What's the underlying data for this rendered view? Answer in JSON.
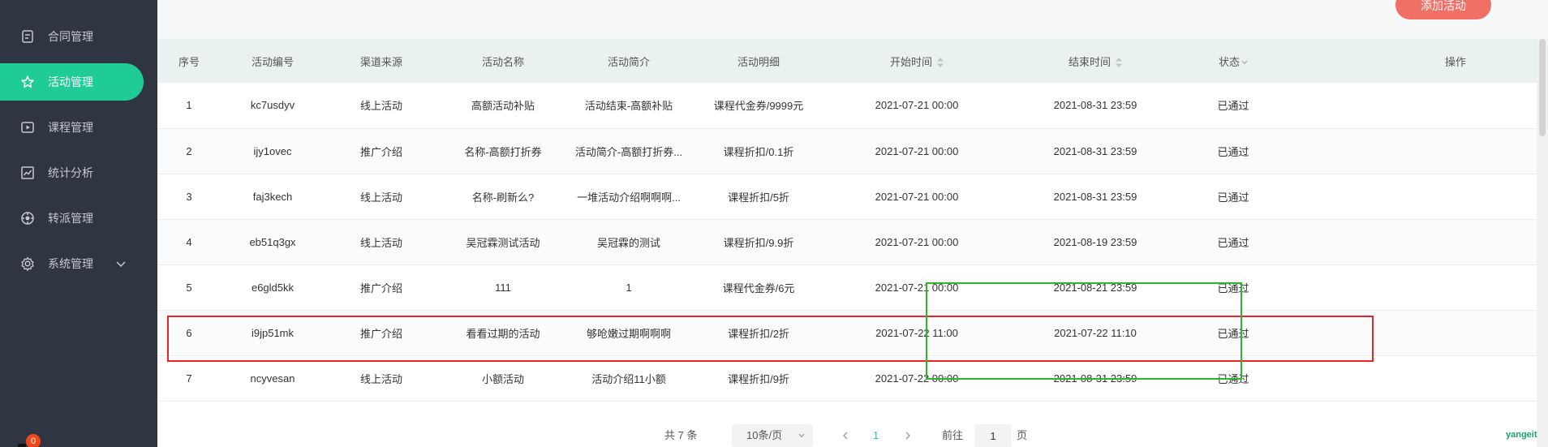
{
  "sidebar": {
    "items": [
      {
        "label": "合同管理",
        "icon": "document-icon"
      },
      {
        "label": "活动管理",
        "icon": "star-icon",
        "active": true
      },
      {
        "label": "课程管理",
        "icon": "play-icon"
      },
      {
        "label": "统计分析",
        "icon": "chart-icon"
      },
      {
        "label": "转派管理",
        "icon": "transfer-icon"
      },
      {
        "label": "系统管理",
        "icon": "gear-icon"
      }
    ],
    "badge": "0"
  },
  "toolbar": {
    "add_label": "添加活动"
  },
  "table": {
    "headers": [
      "序号",
      "活动编号",
      "渠道来源",
      "活动名称",
      "活动简介",
      "活动明细",
      "开始时间",
      "结束时间",
      "状态",
      "操作"
    ],
    "rows": [
      {
        "no": "1",
        "code": "kc7usdyv",
        "channel": "线上活动",
        "name": "高额活动补贴",
        "intro": "活动结束-高额补贴",
        "detail": "课程代金券/9999元",
        "start": "2021-07-21 00:00",
        "end": "2021-08-31 23:59",
        "status": "已通过"
      },
      {
        "no": "2",
        "code": "ijy1ovec",
        "channel": "推广介绍",
        "name": "名称-高额打折券",
        "intro": "活动简介-高额打折券...",
        "detail": "课程折扣/0.1折",
        "start": "2021-07-21 00:00",
        "end": "2021-08-31 23:59",
        "status": "已通过"
      },
      {
        "no": "3",
        "code": "faj3kech",
        "channel": "线上活动",
        "name": "名称-刷新么?",
        "intro": "一堆活动介绍啊啊啊...",
        "detail": "课程折扣/5折",
        "start": "2021-07-21 00:00",
        "end": "2021-08-31 23:59",
        "status": "已通过"
      },
      {
        "no": "4",
        "code": "eb51q3gx",
        "channel": "线上活动",
        "name": "吴冠霖测试活动",
        "intro": "吴冠霖的测试",
        "detail": "课程折扣/9.9折",
        "start": "2021-07-21 00:00",
        "end": "2021-08-19 23:59",
        "status": "已通过"
      },
      {
        "no": "5",
        "code": "e6gld5kk",
        "channel": "推广介绍",
        "name": "111",
        "intro": "1",
        "detail": "课程代金券/6元",
        "start": "2021-07-21 00:00",
        "end": "2021-08-21 23:59",
        "status": "已通过"
      },
      {
        "no": "6",
        "code": "i9jp51mk",
        "channel": "推广介绍",
        "name": "看看过期的活动",
        "intro": "够呛嫩过期啊啊啊",
        "detail": "课程折扣/2折",
        "start": "2021-07-22 11:00",
        "end": "2021-07-22 11:10",
        "status": "已通过"
      },
      {
        "no": "7",
        "code": "ncyvesan",
        "channel": "线上活动",
        "name": "小额活动",
        "intro": "活动介绍11小额",
        "detail": "课程折扣/9折",
        "start": "2021-07-22 00:00",
        "end": "2021-08-31 23:59",
        "status": "已通过"
      }
    ]
  },
  "pagination": {
    "total": "共 7 条",
    "page_size": "10条/页",
    "current_page": "1",
    "goto_label": "前往",
    "goto_value": "1",
    "page_unit": "页"
  },
  "watermark": "yangeit",
  "colors": {
    "accent": "#1fcc96",
    "sidebar": "#303542",
    "add_button": "#f26f66",
    "highlight_red": "#e8242b",
    "highlight_green": "#2db52d"
  }
}
